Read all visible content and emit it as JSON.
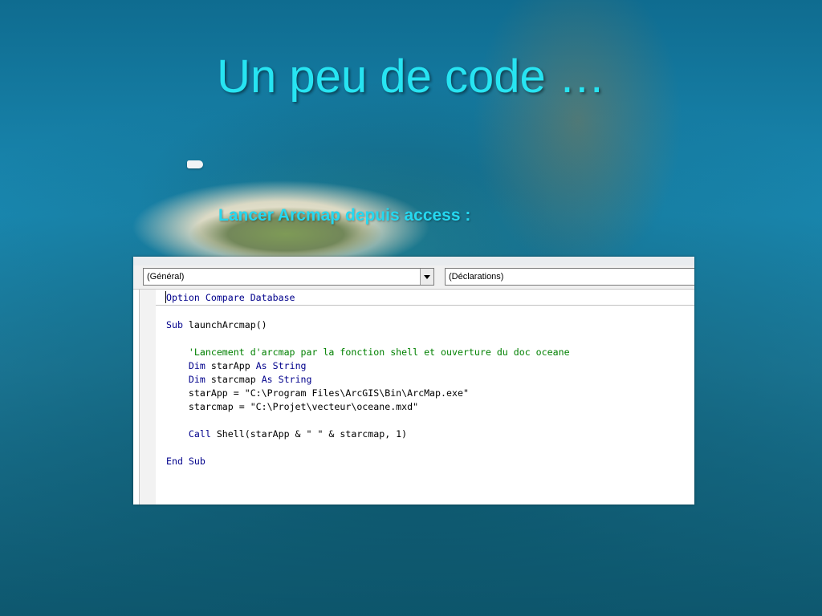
{
  "slide": {
    "title": "Un peu de code …",
    "subtitle": "Lancer Arcmap depuis access :"
  },
  "editor": {
    "object_combo": "(Général)",
    "procedure_combo": "(Déclarations)",
    "lines": {
      "l1_kw": "Option Compare Database",
      "l2_kw": "Sub",
      "l2_rest": " launchArcmap()",
      "l3_comment": "    'Lancement d'arcmap par la fonction shell et ouverture du doc oceane",
      "l4_kw1": "    Dim",
      "l4_id": " starApp ",
      "l4_kw2": "As String",
      "l5_kw1": "    Dim",
      "l5_id": " starcmap ",
      "l5_kw2": "As String",
      "l6": "    starApp = \"C:\\Program Files\\ArcGIS\\Bin\\ArcMap.exe\"",
      "l7": "    starcmap = \"C:\\Projet\\vecteur\\oceane.mxd\"",
      "l8_kw": "    Call",
      "l8_rest": " Shell(starApp & \" \" & starcmap, 1)",
      "l9_kw": "End Sub"
    }
  },
  "colors": {
    "title": "#27e4f2",
    "keyword": "#00008b",
    "comment": "#008000"
  }
}
